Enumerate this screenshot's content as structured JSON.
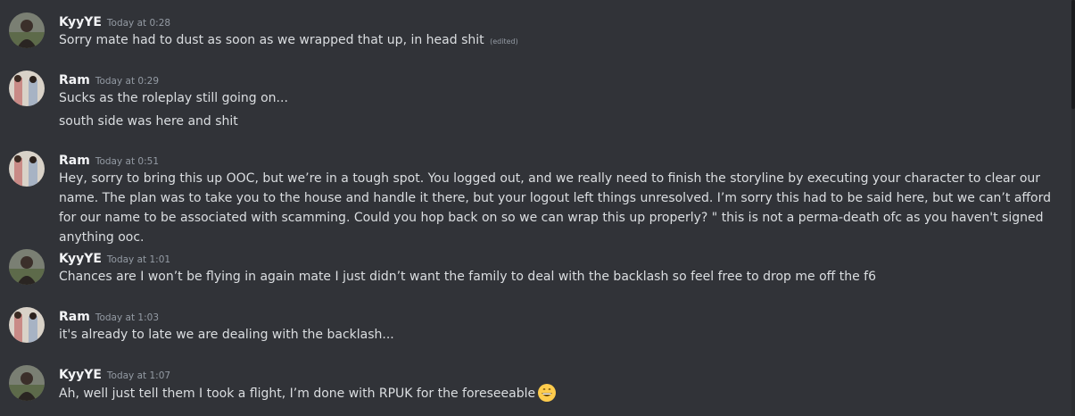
{
  "messages": [
    {
      "username": "KyyYE",
      "timestamp": "Today at 0:28",
      "lines": [
        "Sorry mate had to dust as soon as we wrapped that up, in head shit"
      ],
      "edited_label": "(edited)",
      "avatar_icon": "avatar-kyyye-icon"
    },
    {
      "username": "Ram",
      "timestamp": "Today at 0:29",
      "lines": [
        "Sucks as the roleplay still going on...",
        "south side was here and shit"
      ],
      "avatar_icon": "avatar-ram-icon"
    },
    {
      "username": "Ram",
      "timestamp": "Today at 0:51",
      "lines": [
        "Hey, sorry to bring this up OOC, but we’re in a tough spot. You logged out, and we really need to finish the storyline by executing your character to clear our name. The plan was to take you to the house and handle it there, but your logout left things unresolved. I’m sorry this had to be said here, but we can’t afford for our name to be associated with scamming. Could you hop back on so we can wrap this up properly? \" this is not a perma-death ofc as you haven't signed anything ooc."
      ],
      "avatar_icon": "avatar-ram-icon"
    },
    {
      "username": "KyyYE",
      "timestamp": "Today at 1:01",
      "lines": [
        "Chances are I won’t be flying in again mate I just didn’t want the family to deal with the backlash so feel free to drop me off the f6"
      ],
      "avatar_icon": "avatar-kyyye-icon"
    },
    {
      "username": "Ram",
      "timestamp": "Today at 1:03",
      "lines": [
        "it's already to late we are dealing with the backlash..."
      ],
      "avatar_icon": "avatar-ram-icon"
    },
    {
      "username": "KyyYE",
      "timestamp": "Today at 1:07",
      "lines": [
        "Ah, well just tell them I took a flight, I’m done with RPUK for the foreseeable"
      ],
      "emoji": "grinning-face-emoji",
      "avatar_icon": "avatar-kyyye-icon"
    }
  ],
  "colors": {
    "background": "#313338",
    "username": "#f2f3f5",
    "message_text": "#dbdee1",
    "timestamp": "#949ba4"
  }
}
